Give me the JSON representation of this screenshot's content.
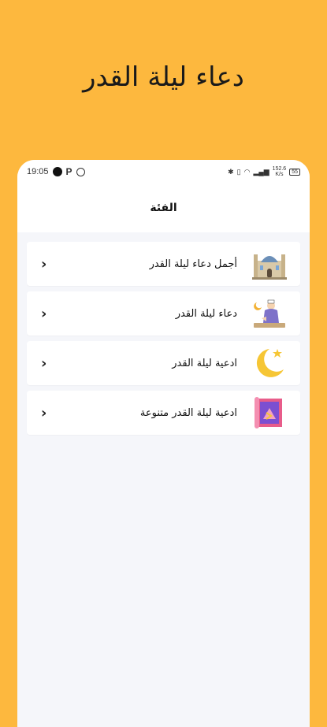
{
  "promo": {
    "title": "دعاء ليلة القدر"
  },
  "status_bar": {
    "time": "19:05",
    "p_badge": "P",
    "speed": "152.6",
    "speed_unit": "K/s",
    "battery": "55"
  },
  "app_bar": {
    "title": "الفئة"
  },
  "categories": [
    {
      "label": "أجمل دعاء ليلة القدر",
      "icon": "mosque-icon"
    },
    {
      "label": "دعاء ليلة القدر",
      "icon": "praying-man-icon"
    },
    {
      "label": "ادعية ليلة القدر",
      "icon": "crescent-moon-icon"
    },
    {
      "label": "ادعية ليلة القدر متنوعة",
      "icon": "prayer-rug-icon"
    }
  ],
  "colors": {
    "background": "#FDB83E",
    "screen": "#F5F6FA"
  }
}
